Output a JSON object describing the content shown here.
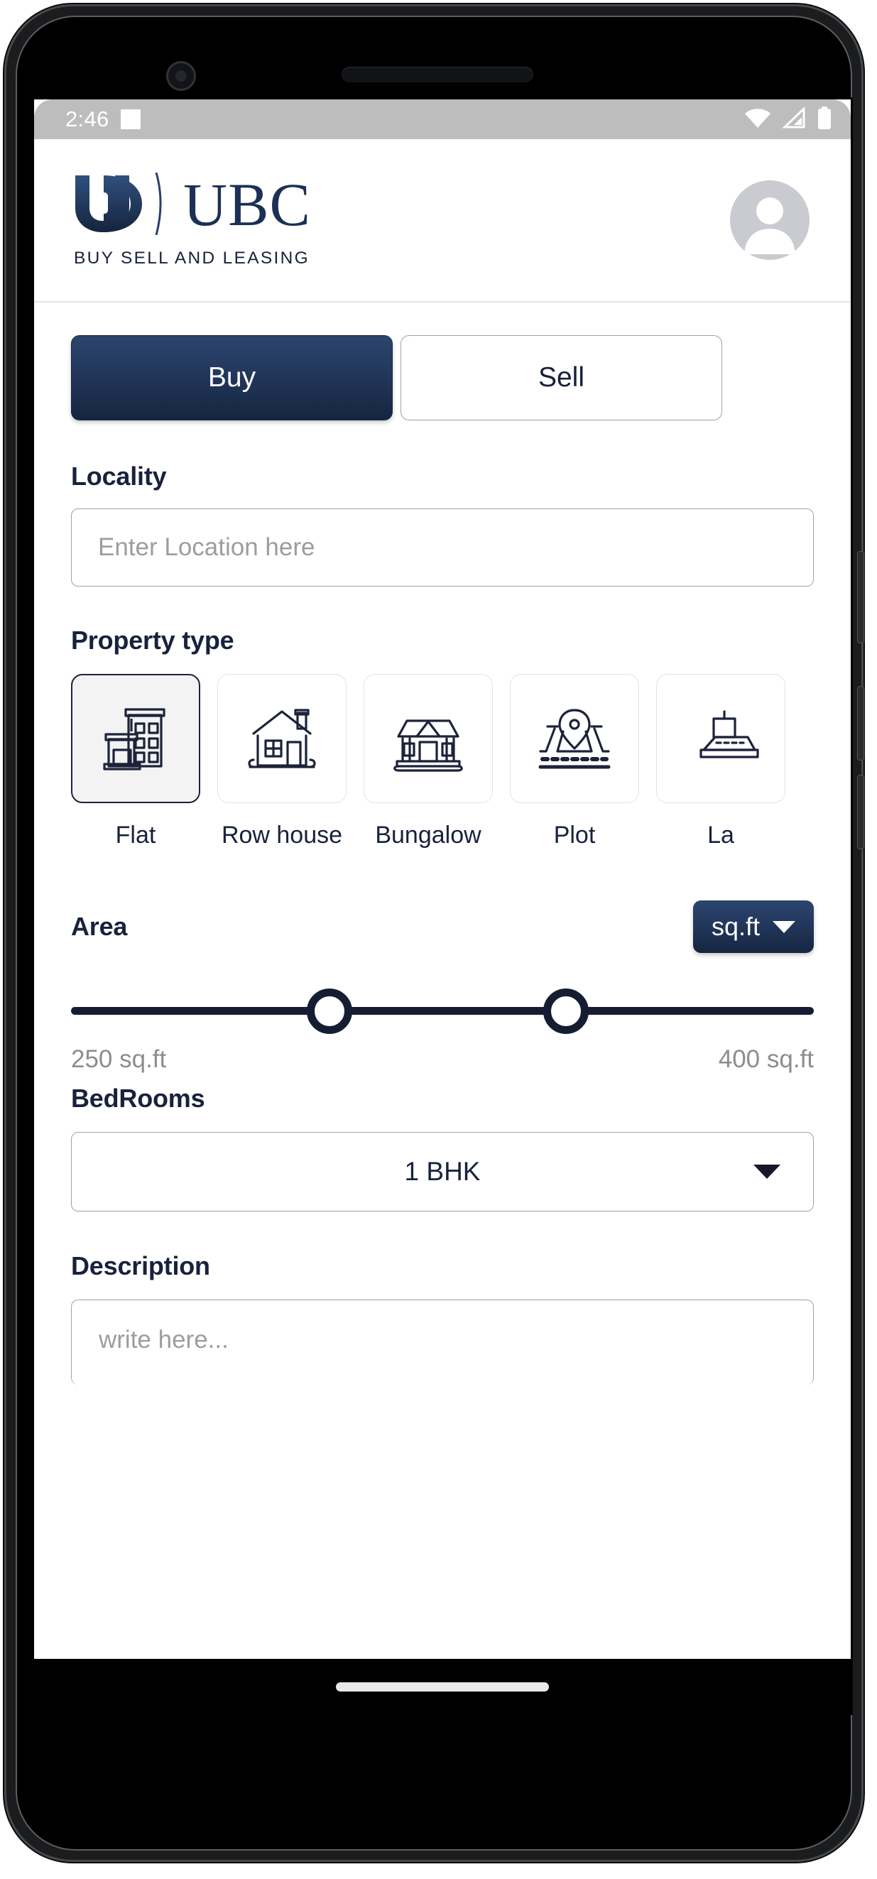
{
  "status_bar": {
    "time": "2:46",
    "notification_icon": "notification-square-icon",
    "wifi_icon": "wifi-icon",
    "signal_icon": "cellular-signal-icon",
    "battery_icon": "battery-full-icon"
  },
  "header": {
    "logo_mark": "ud-monogram-icon",
    "wordmark": "UBC",
    "tagline": "BUY SELL AND LEASING",
    "avatar_icon": "user-avatar-icon"
  },
  "toggle": {
    "buy_label": "Buy",
    "sell_label": "Sell",
    "selected": "Buy"
  },
  "locality": {
    "label": "Locality",
    "placeholder": "Enter Location here",
    "value": ""
  },
  "property_type": {
    "label": "Property type",
    "selected": "Flat",
    "options": [
      {
        "label": "Flat",
        "icon": "apartment-building-icon",
        "selected": true
      },
      {
        "label": "Row house",
        "icon": "house-icon",
        "selected": false
      },
      {
        "label": "Bungalow",
        "icon": "bungalow-icon",
        "selected": false
      },
      {
        "label": "Plot",
        "icon": "map-pin-plot-icon",
        "selected": false
      },
      {
        "label": "La",
        "icon": "land-icon",
        "selected": false
      }
    ]
  },
  "area": {
    "label": "Area",
    "unit_label": "sq.ft",
    "unit_caret_icon": "chevron-down-icon",
    "min_value_label": "250 sq.ft",
    "max_value_label": "400 sq.ft",
    "min_value": 250,
    "max_value": 400
  },
  "bedrooms": {
    "label": "BedRooms",
    "value": "1 BHK",
    "caret_icon": "chevron-down-icon"
  },
  "description": {
    "label": "Description",
    "placeholder": "write here...",
    "value": ""
  },
  "colors": {
    "brand_navy": "#1b3054",
    "ink": "#18223c",
    "muted": "#9d9d9d",
    "border": "#9aa3b2",
    "status_bar": "#bdbdbd"
  }
}
